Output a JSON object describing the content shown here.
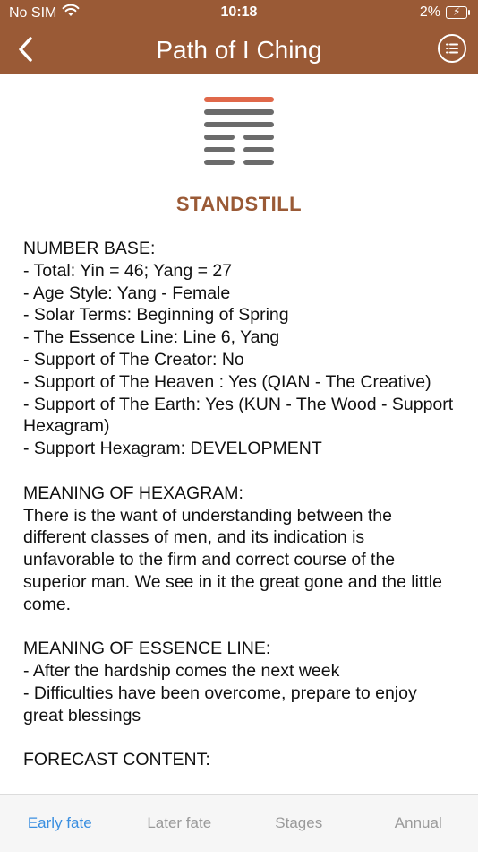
{
  "status_bar": {
    "carrier": "No SIM",
    "time": "10:18",
    "battery": "2%"
  },
  "nav": {
    "title": "Path of I Ching",
    "back_icon": "chevron-left-icon",
    "menu_icon": "list-circle-icon"
  },
  "hexagram": {
    "name": "STANDSTILL",
    "lines_top_to_bottom": [
      "yang",
      "yang",
      "yang",
      "yin",
      "yin",
      "yin"
    ],
    "essence_line_from_top": 1,
    "line_color": "#6b6b6b",
    "essence_color": "#e0684a"
  },
  "sections": {
    "number_base": {
      "heading": "NUMBER BASE:",
      "items": [
        "- Total: Yin = 46; Yang = 27",
        "- Age Style: Yang - Female",
        "- Solar Terms: Beginning of Spring",
        "- The Essence Line: Line 6, Yang",
        "- Support of The Creator: No",
        "- Support of The Heaven : Yes (QIAN - The Creative)",
        "- Support of The Earth: Yes (KUN - The Wood - Support Hexagram)",
        "- Support Hexagram: DEVELOPMENT"
      ]
    },
    "meaning_hexagram": {
      "heading": "MEANING OF HEXAGRAM:",
      "text": "There is the want of understanding between the different classes of men, and its indication is unfavorable to the firm and correct course of the superior man. We see in it the great gone and the little come."
    },
    "meaning_essence": {
      "heading": "MEANING OF ESSENCE LINE:",
      "items": [
        "- After the hardship comes the next week",
        "- Difficulties have been overcome, prepare to enjoy great blessings"
      ]
    },
    "forecast": {
      "heading": "FORECAST CONTENT:"
    }
  },
  "tabs": [
    {
      "label": "Early fate",
      "active": true
    },
    {
      "label": "Later fate",
      "active": false
    },
    {
      "label": "Stages",
      "active": false
    },
    {
      "label": "Annual",
      "active": false
    }
  ],
  "colors": {
    "brand": "#9a5a36",
    "tab_active": "#3b8fe0",
    "tab_inactive": "#9a9a9a"
  }
}
